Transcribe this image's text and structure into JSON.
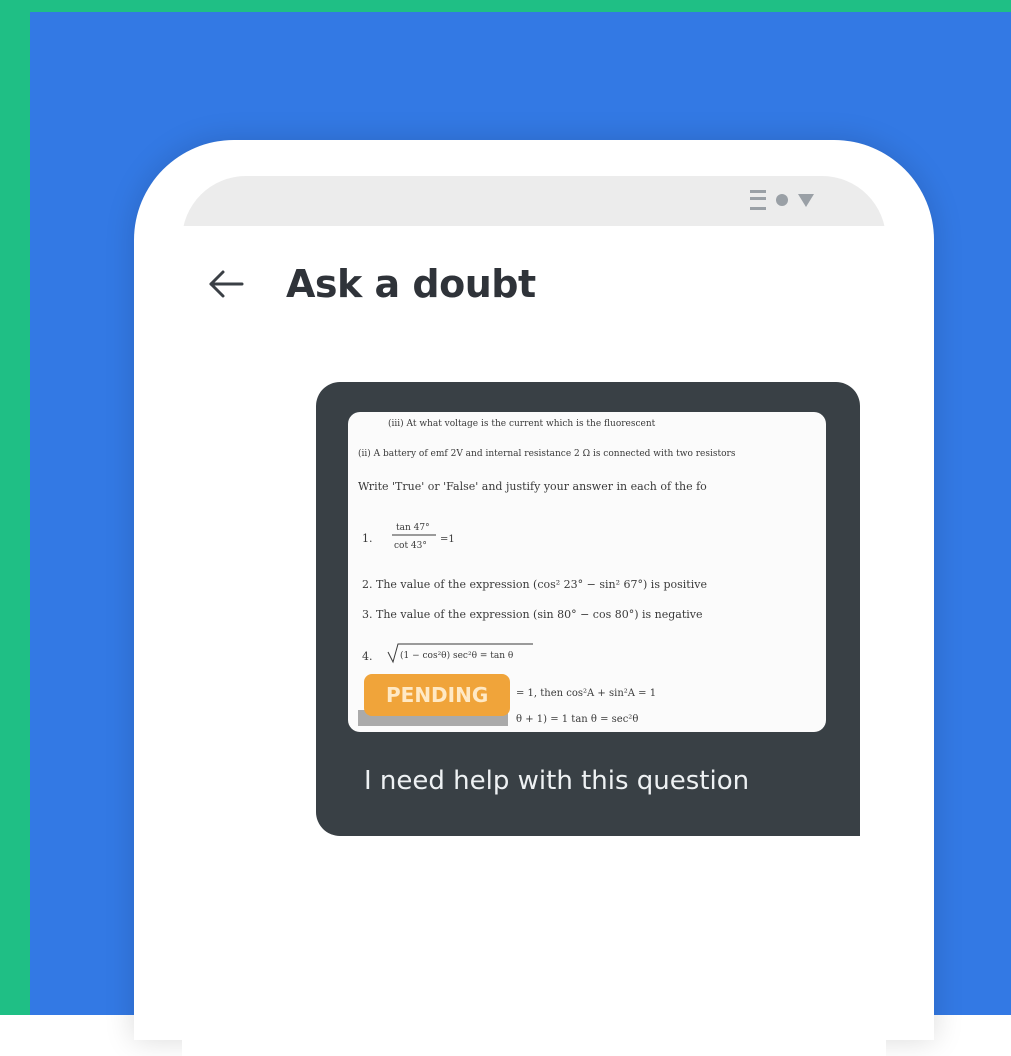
{
  "app": {
    "title": "Ask a doubt"
  },
  "status_bar": {
    "icons": [
      "signal-icon",
      "wifi-icon",
      "battery-icon"
    ]
  },
  "doubt": {
    "status": "PENDING",
    "message": "I need help with this question",
    "attachment": {
      "type": "photo",
      "lines": [
        "(iii) At what voltage is the current which is the fluorescent",
        "(ii) A battery of emf 2V and internal resistance 2 Ω is connected with two resistors",
        "Write 'True' or 'False' and justify your answer in each of the fo",
        "1.",
        "2. The value of the expression (cos² 23° − sin² 67°) is positive",
        "3. The value of the expression (sin 80° − cos 80°) is negative",
        "4.",
        "= 1, then cos²A + sin²A = 1",
        "θ + 1) = 1 tan θ = sec²θ"
      ]
    }
  },
  "colors": {
    "outer_border": "#1fbf85",
    "background": "#3379e4",
    "card": "#394045",
    "badge": "#f0a43a",
    "title_text": "#2f3339"
  }
}
